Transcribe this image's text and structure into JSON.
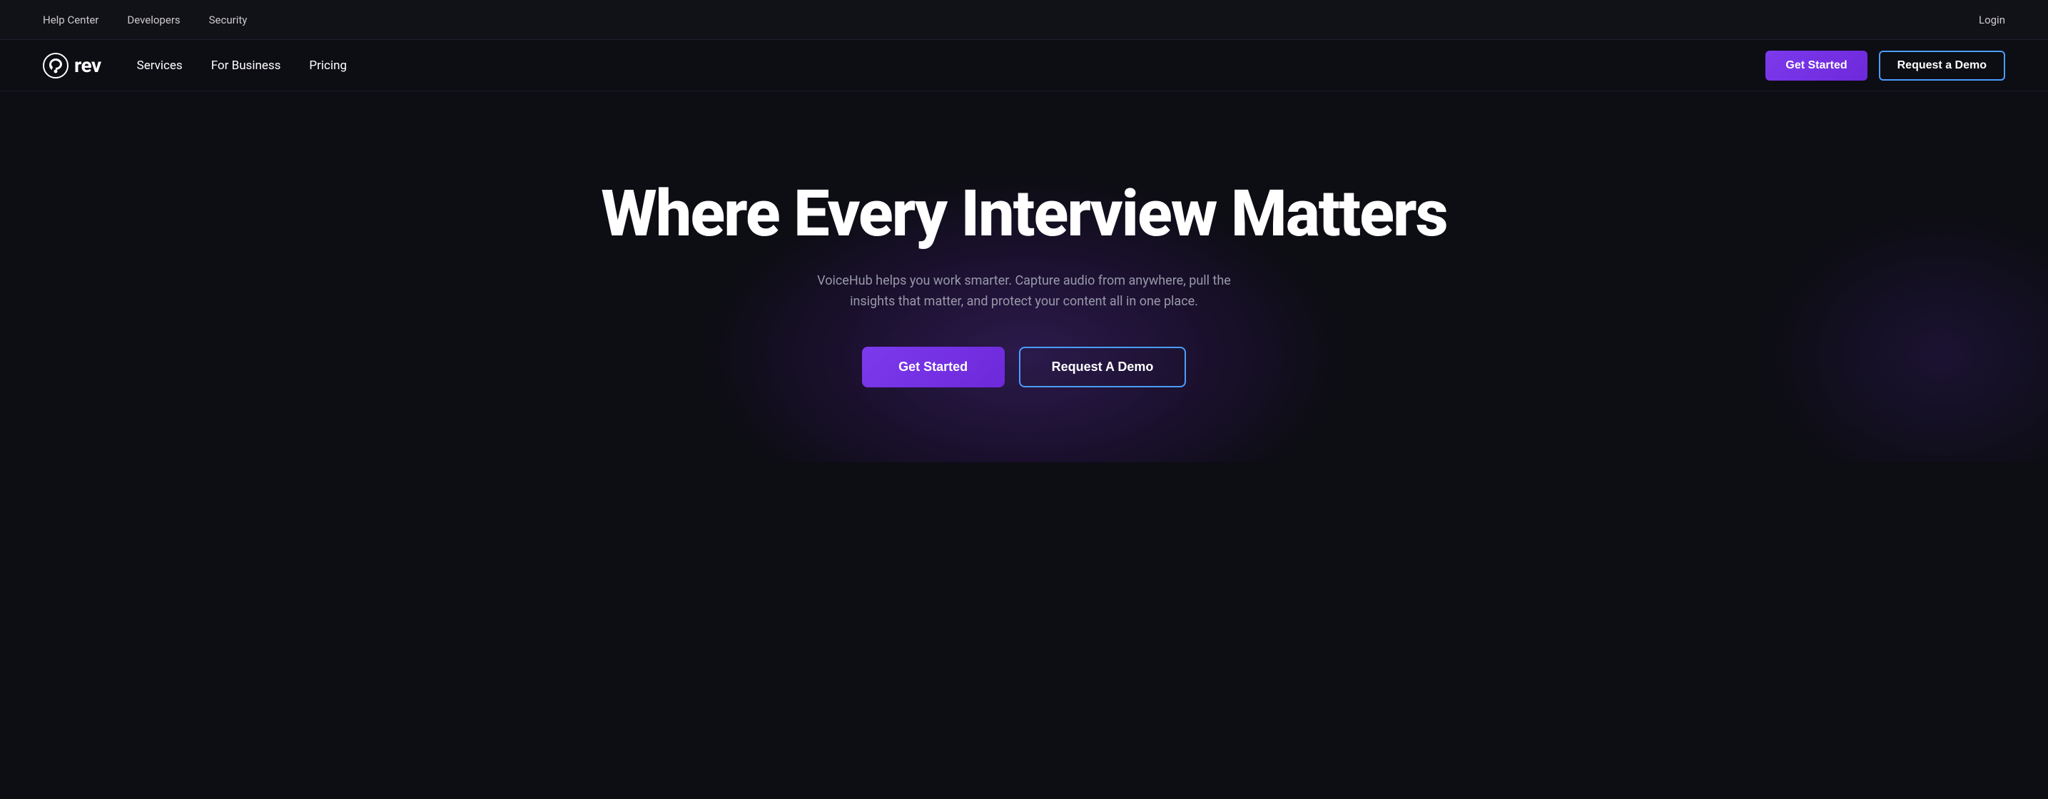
{
  "top_bar": {
    "links": [
      {
        "label": "Help Center",
        "name": "help-center-link"
      },
      {
        "label": "Developers",
        "name": "developers-link"
      },
      {
        "label": "Security",
        "name": "security-link"
      }
    ],
    "login_label": "Login"
  },
  "main_nav": {
    "logo_text": "rev",
    "links": [
      {
        "label": "Services",
        "name": "services-nav-link"
      },
      {
        "label": "For Business",
        "name": "for-business-nav-link"
      },
      {
        "label": "Pricing",
        "name": "pricing-nav-link"
      }
    ],
    "get_started_label": "Get Started",
    "request_demo_label": "Request a Demo"
  },
  "hero": {
    "title": "Where Every Interview Matters",
    "subtitle": "VoiceHub helps you work smarter. Capture audio from anywhere, pull the insights that matter, and protect your content all in one place.",
    "get_started_label": "Get Started",
    "request_demo_label": "Request A Demo"
  }
}
